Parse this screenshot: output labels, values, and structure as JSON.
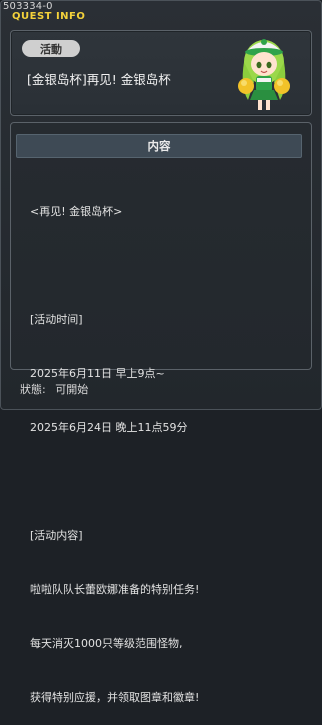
{
  "header": {
    "quest_id": "503334-0",
    "window_title": "QUEST INFO"
  },
  "quest": {
    "category_badge": "活動",
    "title": "[金银岛杯]再见! 金银岛杯",
    "section_label": "内容",
    "content_lines": [
      "<再见! 金银岛杯>",
      "",
      "[活动时间]",
      "2025年6月11日 早上9点~",
      "2025年6月24日 晚上11点59分",
      "",
      "[活动内容]",
      "啦啦队队长蕾欧娜准备的特别任务!",
      "每天消灭1000只等级范围怪物,",
      "获得特别应援，并领取图章和徽章!"
    ]
  },
  "status": {
    "label": "狀態:",
    "value": "可開始"
  }
}
